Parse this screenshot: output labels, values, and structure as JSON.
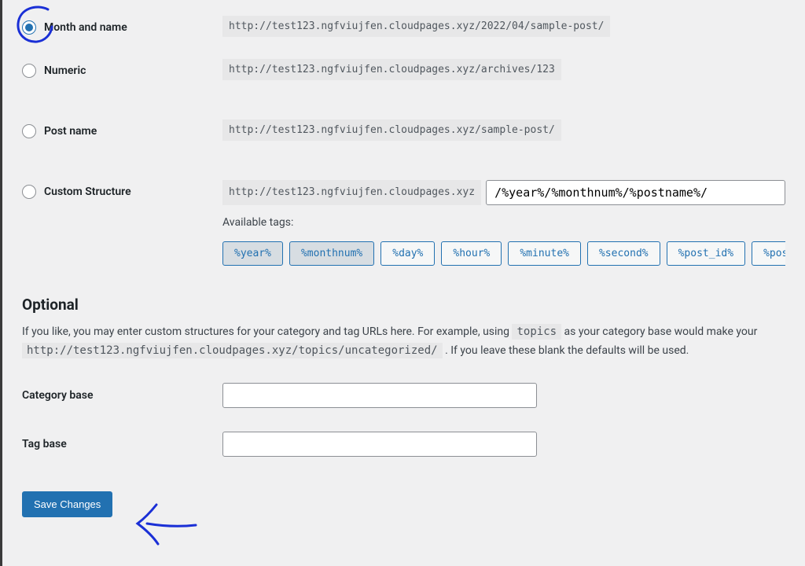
{
  "options": {
    "month_name": {
      "label": "Month and name",
      "url": "http://test123.ngfviujfen.cloudpages.xyz/2022/04/sample-post/",
      "checked": true
    },
    "numeric": {
      "label": "Numeric",
      "url": "http://test123.ngfviujfen.cloudpages.xyz/archives/123",
      "checked": false
    },
    "post_name": {
      "label": "Post name",
      "url": "http://test123.ngfviujfen.cloudpages.xyz/sample-post/",
      "checked": false
    },
    "custom": {
      "label": "Custom Structure",
      "prefix": "http://test123.ngfviujfen.cloudpages.xyz",
      "value": "/%year%/%monthnum%/%postname%/",
      "checked": false
    }
  },
  "available_tags_label": "Available tags:",
  "tags": [
    {
      "text": "%year%",
      "active": true
    },
    {
      "text": "%monthnum%",
      "active": true
    },
    {
      "text": "%day%",
      "active": false
    },
    {
      "text": "%hour%",
      "active": false
    },
    {
      "text": "%minute%",
      "active": false
    },
    {
      "text": "%second%",
      "active": false
    },
    {
      "text": "%post_id%",
      "active": false
    },
    {
      "text": "%postname%",
      "active": false
    }
  ],
  "optional": {
    "heading": "Optional",
    "desc_1": "If you like, you may enter custom structures for your category and tag URLs here. For example, using ",
    "desc_code1": "topics",
    "desc_2": " as your category base would make your ",
    "desc_code2": "http://test123.ngfviujfen.cloudpages.xyz/topics/uncategorized/",
    "desc_3": " . If you leave these blank the defaults will be used."
  },
  "category_base_label": "Category base",
  "category_base_value": "",
  "tag_base_label": "Tag base",
  "tag_base_value": "",
  "save_label": "Save Changes"
}
